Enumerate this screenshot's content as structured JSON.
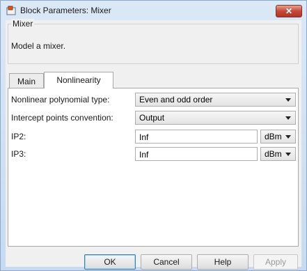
{
  "window": {
    "title": "Block Parameters: Mixer",
    "close_label": "✕"
  },
  "block": {
    "group_title": "Mixer",
    "description": "Model a mixer."
  },
  "tabs": [
    {
      "label": "Main",
      "active": false
    },
    {
      "label": "Nonlinearity",
      "active": true
    }
  ],
  "params": {
    "poly_type_label": "Nonlinear polynomial type:",
    "poly_type_value": "Even and odd order",
    "intercept_label": "Intercept points convention:",
    "intercept_value": "Output",
    "ip2_label": "IP2:",
    "ip2_value": "Inf",
    "ip2_unit": "dBm",
    "ip3_label": "IP3:",
    "ip3_value": "Inf",
    "ip3_unit": "dBm"
  },
  "buttons": {
    "ok": "OK",
    "cancel": "Cancel",
    "help": "Help",
    "apply": "Apply"
  },
  "colors": {
    "title_bar": "#cfe0f3",
    "close_button": "#c4493a",
    "panel": "#f0f0f0"
  }
}
